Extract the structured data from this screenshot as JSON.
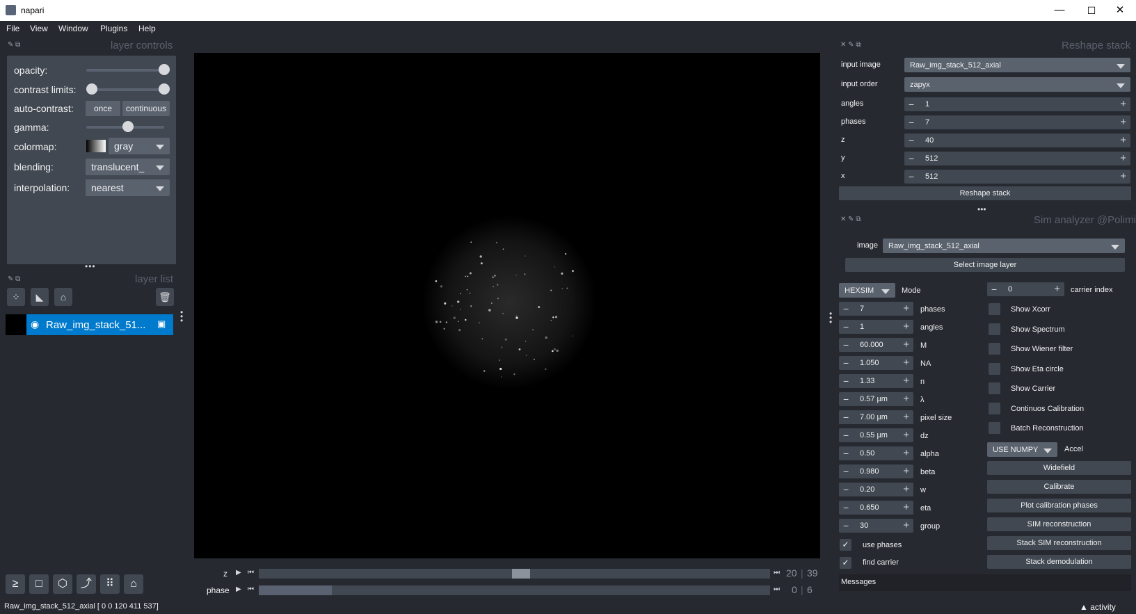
{
  "window": {
    "title": "napari",
    "min": "—",
    "max": "☐",
    "close": "✕"
  },
  "menu": [
    "File",
    "View",
    "Window",
    "Plugins",
    "Help"
  ],
  "layer_controls": {
    "title": "layer controls",
    "opacity_label": "opacity:",
    "contrast_label": "contrast limits:",
    "autocontrast_label": "auto-contrast:",
    "once": "once",
    "continuous": "continuous",
    "gamma_label": "gamma:",
    "colormap_label": "colormap:",
    "colormap_value": "gray",
    "blending_label": "blending:",
    "blending_value": "translucent_",
    "interpolation_label": "interpolation:",
    "interpolation_value": "nearest",
    "opacity": 1.0,
    "gamma": 0.5
  },
  "layer_list": {
    "title": "layer list",
    "layer_name": "Raw_img_stack_51..."
  },
  "dims": {
    "z_label": "z",
    "z_value": "20",
    "z_max": "39",
    "phase_label": "phase",
    "phase_value": "0",
    "phase_max": "6"
  },
  "status_text": "Raw_img_stack_512_axial [ 0   0 120 411 537]",
  "activity": "activity",
  "reshape": {
    "title": "Reshape stack",
    "input_image_label": "input image",
    "input_image_value": "Raw_img_stack_512_axial",
    "input_order_label": "input order",
    "input_order_value": "zapyx",
    "fields": [
      {
        "label": "angles",
        "value": "1"
      },
      {
        "label": "phases",
        "value": "7"
      },
      {
        "label": "z",
        "value": "40"
      },
      {
        "label": "y",
        "value": "512"
      },
      {
        "label": "x",
        "value": "512"
      }
    ],
    "button": "Reshape stack"
  },
  "sim": {
    "title": "Sim analyzer @Polimi",
    "image_label": "image",
    "image_value": "Raw_img_stack_512_axial",
    "select_button": "Select image layer",
    "mode_value": "HEXSIM",
    "mode_label": "Mode",
    "carrier_value": "0",
    "carrier_label": "carrier index",
    "params": [
      {
        "value": "7",
        "label": "phases"
      },
      {
        "value": "1",
        "label": "angles"
      },
      {
        "value": "60.000",
        "label": "M"
      },
      {
        "value": "1.050",
        "label": "NA"
      },
      {
        "value": "1.33",
        "label": "n"
      },
      {
        "value": "0.57 µm",
        "label": "λ"
      },
      {
        "value": "7.00 µm",
        "label": "pixel size"
      },
      {
        "value": "0.55 µm",
        "label": "dz"
      },
      {
        "value": "0.50",
        "label": "alpha"
      },
      {
        "value": "0.980",
        "label": "beta"
      },
      {
        "value": "0.20",
        "label": "w"
      },
      {
        "value": "0.650",
        "label": "eta"
      },
      {
        "value": "30",
        "label": "group"
      }
    ],
    "use_phases": "use phases",
    "find_carrier": "find carrier",
    "checks": [
      "Show Xcorr",
      "Show Spectrum",
      "Show Wiener filter",
      "Show Eta circle",
      "Show Carrier",
      "Continuos Calibration",
      "Batch Reconstruction"
    ],
    "accel_value": "USE NUMPY",
    "accel_label": "Accel",
    "buttons": [
      "Widefield",
      "Calibrate",
      "Plot calibration phases",
      "SIM reconstruction",
      "Stack SIM reconstruction",
      "Stack demodulation"
    ],
    "messages": "Messages"
  }
}
